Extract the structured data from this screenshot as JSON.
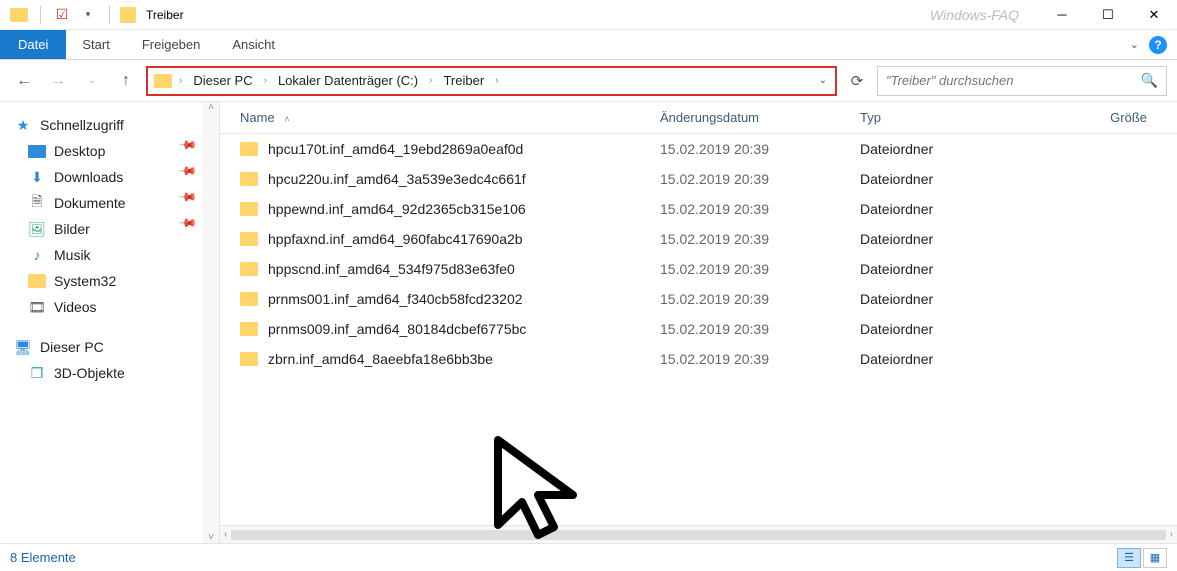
{
  "window": {
    "title": "Treiber",
    "watermark": "Windows-FAQ"
  },
  "ribbon": {
    "file": "Datei",
    "tabs": [
      "Start",
      "Freigeben",
      "Ansicht"
    ]
  },
  "breadcrumb": {
    "parts": [
      "Dieser PC",
      "Lokaler Datenträger (C:)",
      "Treiber"
    ]
  },
  "search": {
    "placeholder": "\"Treiber\" durchsuchen"
  },
  "sidebar": {
    "quick_access": "Schnellzugriff",
    "items": [
      {
        "label": "Desktop",
        "pinned": true
      },
      {
        "label": "Downloads",
        "pinned": true
      },
      {
        "label": "Dokumente",
        "pinned": true
      },
      {
        "label": "Bilder",
        "pinned": true
      },
      {
        "label": "Musik",
        "pinned": false
      },
      {
        "label": "System32",
        "pinned": false
      },
      {
        "label": "Videos",
        "pinned": false
      }
    ],
    "this_pc": "Dieser PC",
    "three_d": "3D-Objekte"
  },
  "columns": {
    "name": "Name",
    "date": "Änderungsdatum",
    "type": "Typ",
    "size": "Größe"
  },
  "files": [
    {
      "name": "hpcu170t.inf_amd64_19ebd2869a0eaf0d",
      "date": "15.02.2019 20:39",
      "type": "Dateiordner"
    },
    {
      "name": "hpcu220u.inf_amd64_3a539e3edc4c661f",
      "date": "15.02.2019 20:39",
      "type": "Dateiordner"
    },
    {
      "name": "hppewnd.inf_amd64_92d2365cb315e106",
      "date": "15.02.2019 20:39",
      "type": "Dateiordner"
    },
    {
      "name": "hppfaxnd.inf_amd64_960fabc417690a2b",
      "date": "15.02.2019 20:39",
      "type": "Dateiordner"
    },
    {
      "name": "hppscnd.inf_amd64_534f975d83e63fe0",
      "date": "15.02.2019 20:39",
      "type": "Dateiordner"
    },
    {
      "name": "prnms001.inf_amd64_f340cb58fcd23202",
      "date": "15.02.2019 20:39",
      "type": "Dateiordner"
    },
    {
      "name": "prnms009.inf_amd64_80184dcbef6775bc",
      "date": "15.02.2019 20:39",
      "type": "Dateiordner"
    },
    {
      "name": "zbrn.inf_amd64_8aeebfa18e6bb3be",
      "date": "15.02.2019 20:39",
      "type": "Dateiordner"
    }
  ],
  "status": {
    "count": "8 Elemente"
  }
}
